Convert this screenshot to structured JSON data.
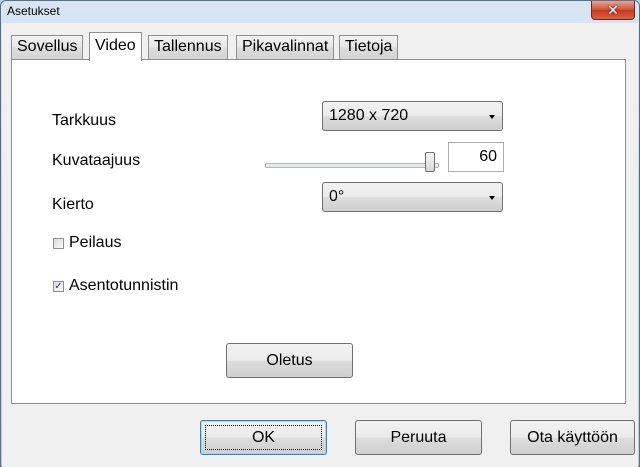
{
  "window": {
    "title": "Asetukset",
    "close_glyph": "✕"
  },
  "tabs": [
    {
      "label": "Sovellus",
      "active": false
    },
    {
      "label": "Video",
      "active": true
    },
    {
      "label": "Tallennus",
      "active": false
    },
    {
      "label": "Pikavalinnat",
      "active": false
    },
    {
      "label": "Tietoja",
      "active": false
    }
  ],
  "video": {
    "resolution_label": "Tarkkuus",
    "resolution_value": "1280 x 720",
    "framerate_label": "Kuvataajuus",
    "framerate_value": "60",
    "rotation_label": "Kierto",
    "rotation_value": "0°",
    "mirror_label": "Peilaus",
    "mirror_checked": false,
    "orientation_label": "Asentotunnistin",
    "orientation_checked": true,
    "orientation_check_glyph": "✓",
    "defaults_button": "Oletus"
  },
  "footer": {
    "ok_button": "OK",
    "cancel_button": "Peruuta",
    "apply_button": "Ota käyttöön"
  }
}
